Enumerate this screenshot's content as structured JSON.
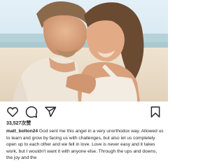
{
  "post": {
    "likes_text": "33,527次赞",
    "username": "matt_bolton24",
    "caption": "God sent me this angel in a very unorthodox way. Allowed us to learn and grow by facing us with challenges, but also let us completely open up to each other and we fell in love. Love is never easy and it takes work, but I wouldn't want it with anyone else. Through the ups and downs, the joy and the"
  },
  "icons": {
    "like": "heart-icon",
    "comment": "comment-icon",
    "share": "share-icon",
    "save": "bookmark-icon"
  },
  "colors": {
    "text": "#262626",
    "icon": "#262626",
    "sky": "#cfe6f3",
    "sea": "#bcd6dc",
    "sand": "#e9dcc8"
  }
}
